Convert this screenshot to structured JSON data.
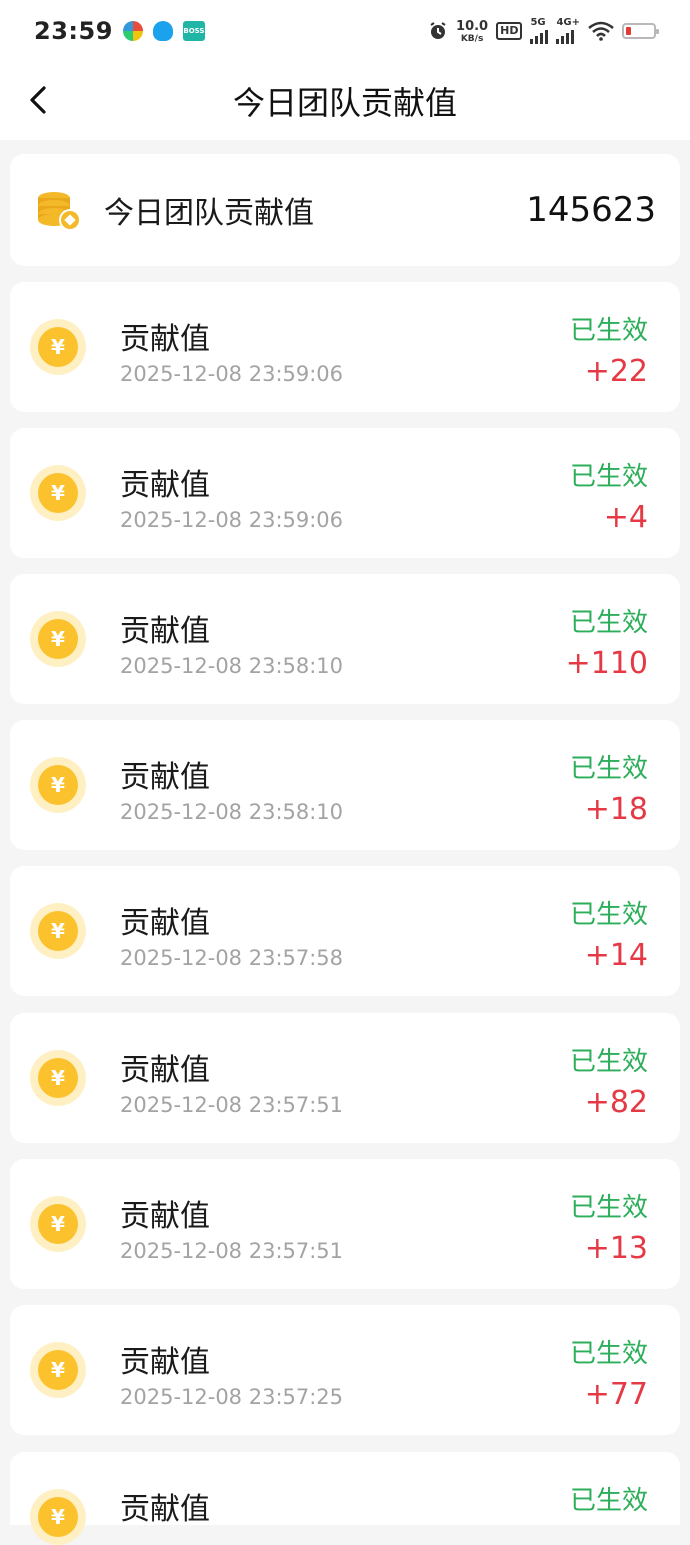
{
  "status_bar": {
    "time": "23:59",
    "speed_value": "10.0",
    "speed_unit": "KB/s",
    "hd_label": "HD",
    "sim1_label": "5G",
    "sim2_label": "4G+",
    "boss_label": "BOSS\n直聘",
    "icons": [
      "colorful-app-icon",
      "qq-icon",
      "boss-app-icon",
      "alarm-icon",
      "hd-icon",
      "signal-icon",
      "wifi-icon",
      "battery-icon"
    ]
  },
  "nav": {
    "back_icon": "chevron-left-icon",
    "title": "今日团队贡献值"
  },
  "summary": {
    "icon": "coin-stack-icon",
    "label": "今日团队贡献值",
    "value": "145623"
  },
  "records": [
    {
      "title": "贡献值",
      "time": "2025-12-08 23:59:06",
      "status": "已生效",
      "amount": "+22"
    },
    {
      "title": "贡献值",
      "time": "2025-12-08 23:59:06",
      "status": "已生效",
      "amount": "+4"
    },
    {
      "title": "贡献值",
      "time": "2025-12-08 23:58:10",
      "status": "已生效",
      "amount": "+110"
    },
    {
      "title": "贡献值",
      "time": "2025-12-08 23:58:10",
      "status": "已生效",
      "amount": "+18"
    },
    {
      "title": "贡献值",
      "time": "2025-12-08 23:57:58",
      "status": "已生效",
      "amount": "+14"
    },
    {
      "title": "贡献值",
      "time": "2025-12-08 23:57:51",
      "status": "已生效",
      "amount": "+82"
    },
    {
      "title": "贡献值",
      "time": "2025-12-08 23:57:51",
      "status": "已生效",
      "amount": "+13"
    },
    {
      "title": "贡献值",
      "time": "2025-12-08 23:57:25",
      "status": "已生效",
      "amount": "+77"
    },
    {
      "title": "贡献值",
      "time": "",
      "status": "已生效",
      "amount": ""
    }
  ],
  "coin_symbol": "¥",
  "colors": {
    "status_green": "#2dae5b",
    "amount_red": "#e53a45",
    "coin_yellow": "#fbc22d",
    "background": "#f5f5f5"
  }
}
